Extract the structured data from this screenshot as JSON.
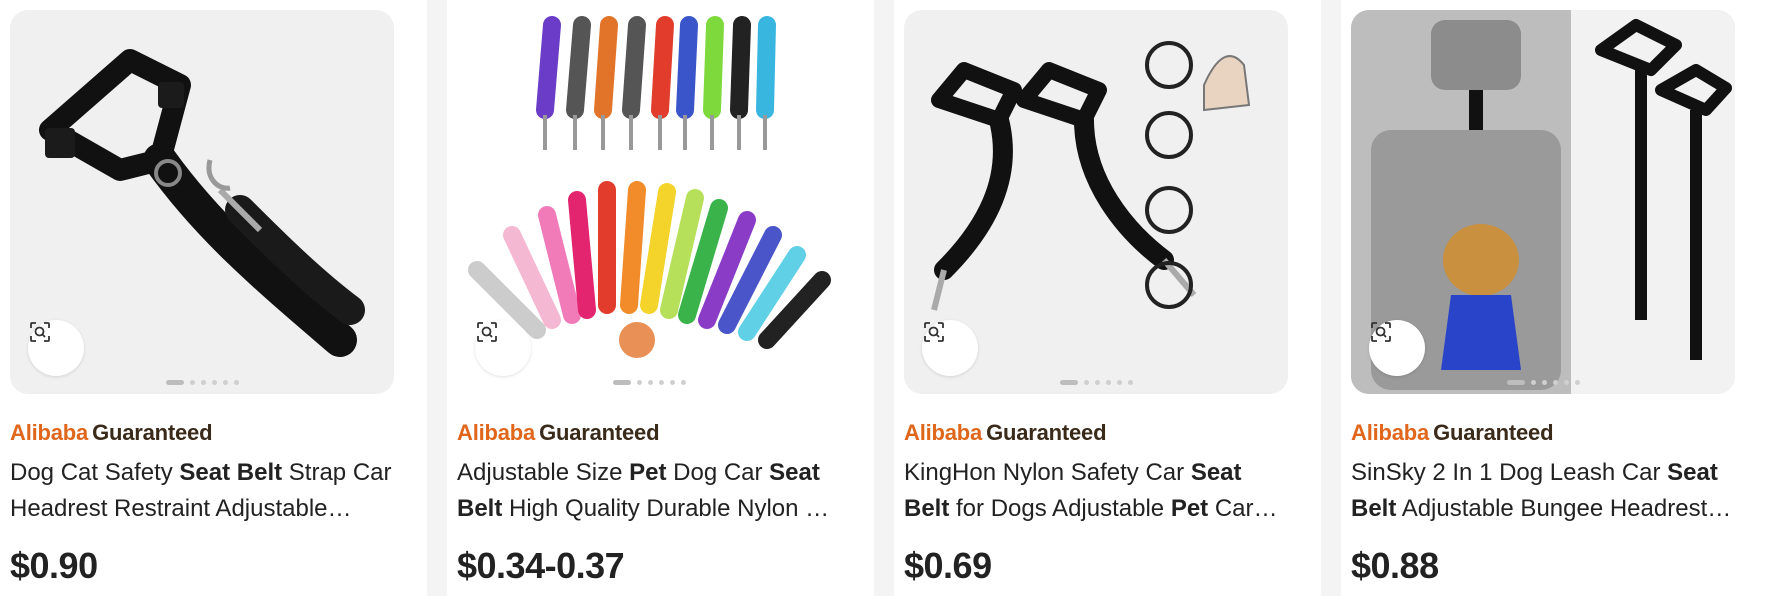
{
  "cards": [
    {
      "badge_part1": "Alibaba",
      "badge_part2": "Guaranteed",
      "title_segments": [
        {
          "text": "Dog Cat Safety ",
          "bold": false
        },
        {
          "text": "Seat Belt",
          "bold": true
        },
        {
          "text": " Strap Car Headrest Restraint Adjustable Nylon Fabric Dog Restraints",
          "bold": false
        }
      ],
      "price": "$0.90"
    },
    {
      "badge_part1": "Alibaba",
      "badge_part2": "Guaranteed",
      "title_segments": [
        {
          "text": "Adjustable Size ",
          "bold": false
        },
        {
          "text": "Pet",
          "bold": true
        },
        {
          "text": " Dog Car ",
          "bold": false
        },
        {
          "text": "Seat Belt",
          "bold": true
        },
        {
          "text": " High Quality Durable Nylon Pet Car Seat Belt",
          "bold": false
        }
      ],
      "price": "$0.34-0.37"
    },
    {
      "badge_part1": "Alibaba",
      "badge_part2": "Guaranteed",
      "title_segments": [
        {
          "text": "KingHon Nylon Safety Car ",
          "bold": false
        },
        {
          "text": "Seat Belt",
          "bold": true
        },
        {
          "text": " for Dogs Adjustable ",
          "bold": false
        },
        {
          "text": "Pet",
          "bold": true
        },
        {
          "text": " Car Seatbelt",
          "bold": false
        }
      ],
      "price": "$0.69"
    },
    {
      "badge_part1": "Alibaba",
      "badge_part2": "Guaranteed",
      "title_segments": [
        {
          "text": "SinSky 2 In 1 Dog Leash Car ",
          "bold": false
        },
        {
          "text": "Seat Belt",
          "bold": true
        },
        {
          "text": " Adjustable Bungee Headrest Restraint",
          "bold": false
        }
      ],
      "price": "$0.88"
    }
  ],
  "icons": {
    "image_search": "image-search-icon"
  },
  "colors": {
    "badge_orange": "#e0661b",
    "badge_brown": "#3a2a1a",
    "text": "#222222",
    "page_bg": "#f4f4f4"
  }
}
